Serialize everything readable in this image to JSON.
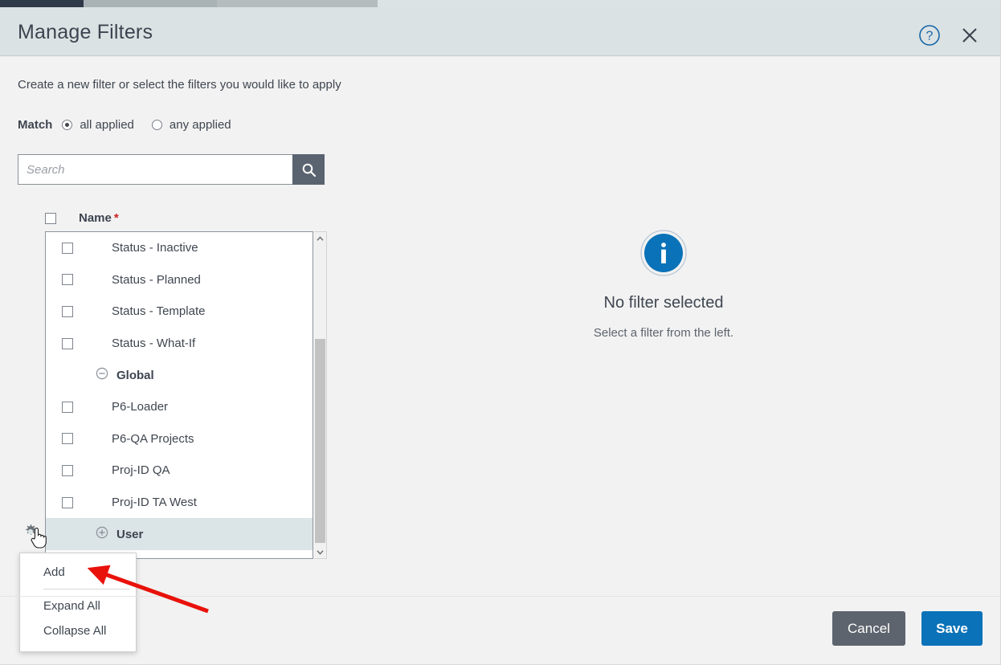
{
  "window": {
    "tabs": [
      {
        "name": "active-tab",
        "state": "active"
      },
      {
        "name": "background-tab-1",
        "state": "inactive"
      },
      {
        "name": "background-tab-2",
        "state": "inactive"
      }
    ]
  },
  "header": {
    "title": "Manage Filters",
    "help_icon": "help-circle-icon",
    "close_icon": "close-x-icon"
  },
  "body": {
    "intro": "Create a new filter or select the filters you would like to apply",
    "match": {
      "label": "Match",
      "options": [
        {
          "label": "all applied",
          "selected": true
        },
        {
          "label": "any applied",
          "selected": false
        }
      ]
    },
    "search": {
      "placeholder": "Search",
      "value": "",
      "button_icon": "search-icon"
    },
    "list": {
      "header": {
        "select_all_checked": false,
        "column_name": "Name",
        "required_marker": "*"
      },
      "rows": [
        {
          "type": "item",
          "label": "Status - Inactive",
          "checked": false
        },
        {
          "type": "item",
          "label": "Status - Planned",
          "checked": false
        },
        {
          "type": "item",
          "label": "Status - Template",
          "checked": false
        },
        {
          "type": "item",
          "label": "Status - What-If",
          "checked": false
        },
        {
          "type": "group",
          "label": "Global",
          "expanded": true,
          "toggle_icon": "circle-minus-icon",
          "selected": false
        },
        {
          "type": "item",
          "label": "P6-Loader",
          "checked": false
        },
        {
          "type": "item",
          "label": "P6-QA Projects",
          "checked": false
        },
        {
          "type": "item",
          "label": "Proj-ID QA",
          "checked": false
        },
        {
          "type": "item",
          "label": "Proj-ID TA West",
          "checked": false
        },
        {
          "type": "group",
          "label": "User",
          "expanded": false,
          "toggle_icon": "circle-plus-icon",
          "selected": true
        }
      ],
      "scrollbar": {
        "up_arrow": "chevron-up-icon",
        "down_arrow": "chevron-down-icon"
      }
    },
    "gear_menu": {
      "trigger_icon": "gear-icon",
      "items": [
        {
          "label": "Add"
        },
        {
          "label": "Expand All"
        },
        {
          "label": "Collapse All"
        }
      ]
    },
    "empty_state": {
      "icon": "info-circle-icon",
      "title": "No filter selected",
      "subtitle": "Select a filter from the left."
    }
  },
  "footer": {
    "cancel_label": "Cancel",
    "save_label": "Save"
  },
  "colors": {
    "header_bg": "#dbe2e3",
    "body_bg": "#f2f2f2",
    "accent_blue": "#0a72b8",
    "cancel_gray": "#5e646d",
    "search_button": "#5a6370",
    "required_red": "#cc2222",
    "annotation_red": "#e8120b",
    "selected_row": "#dbe4e6",
    "tab_active": "#2e3a4a"
  },
  "annotation": {
    "type": "arrow",
    "color": "#e8120b",
    "points_to": "Add"
  }
}
